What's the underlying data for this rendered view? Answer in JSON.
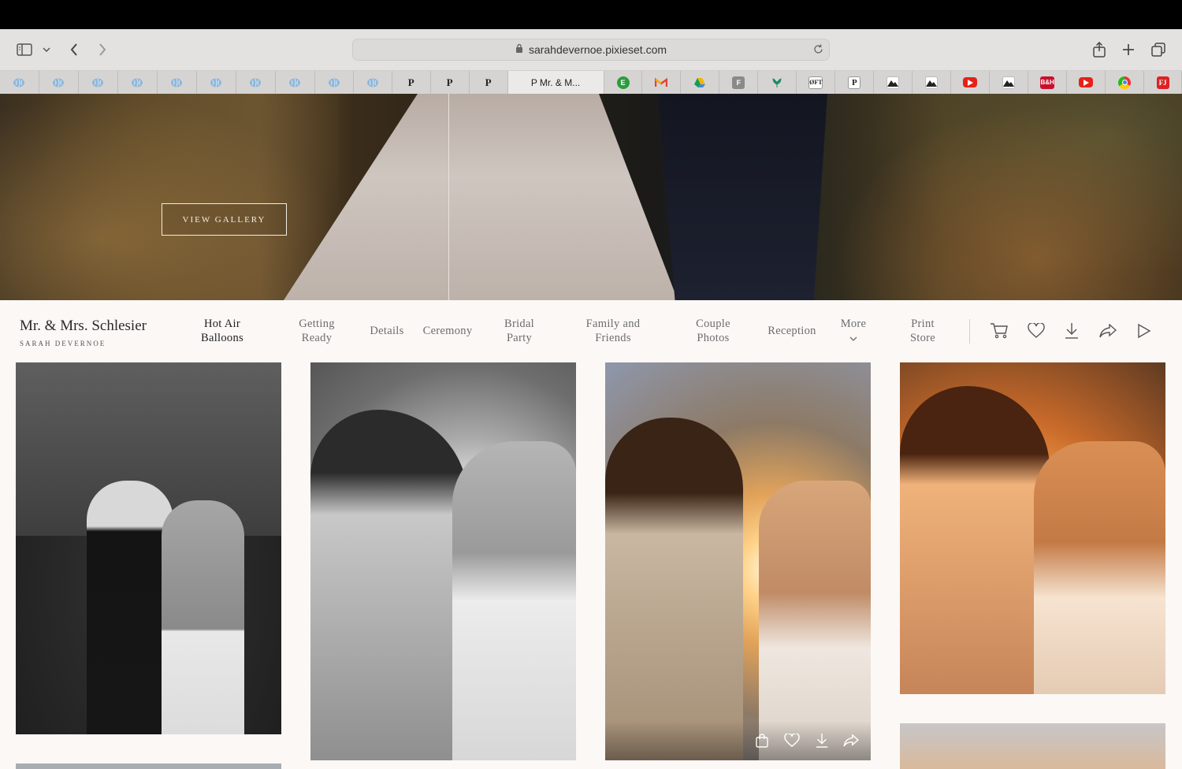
{
  "browser": {
    "url": "sarahdevernoe.pixieset.com",
    "tabs": [
      {
        "favicon": "pinterest-like-blue-icon",
        "label": ""
      },
      {
        "favicon": "pinterest-like-blue-icon",
        "label": ""
      },
      {
        "favicon": "pinterest-like-blue-icon",
        "label": ""
      },
      {
        "favicon": "pinterest-like-blue-icon",
        "label": ""
      },
      {
        "favicon": "pinterest-like-blue-icon",
        "label": ""
      },
      {
        "favicon": "pinterest-like-blue-icon",
        "label": ""
      },
      {
        "favicon": "pinterest-like-blue-icon",
        "label": ""
      },
      {
        "favicon": "pinterest-like-blue-icon",
        "label": ""
      },
      {
        "favicon": "pinterest-like-blue-icon",
        "label": ""
      },
      {
        "favicon": "pinterest-like-blue-icon",
        "label": ""
      },
      {
        "favicon": "pixieset-icon",
        "label": "P"
      },
      {
        "favicon": "pixieset-icon",
        "label": "P"
      },
      {
        "favicon": "pixieset-icon",
        "label": "P"
      },
      {
        "favicon": "pixieset-icon",
        "label": "P  Mr. & M..."
      },
      {
        "favicon": "green-circle-icon",
        "label": ""
      },
      {
        "favicon": "gmail-icon",
        "label": ""
      },
      {
        "favicon": "google-drive-icon",
        "label": ""
      },
      {
        "favicon": "f-icon",
        "label": ""
      },
      {
        "favicon": "plant-icon",
        "label": ""
      },
      {
        "favicon": "ft-icon",
        "label": ""
      },
      {
        "favicon": "p-box-icon",
        "label": ""
      },
      {
        "favicon": "mountain-icon",
        "label": ""
      },
      {
        "favicon": "mountain-icon",
        "label": ""
      },
      {
        "favicon": "youtube-icon",
        "label": ""
      },
      {
        "favicon": "mountain-icon",
        "label": ""
      },
      {
        "favicon": "bh-icon",
        "label": ""
      },
      {
        "favicon": "youtube-icon",
        "label": ""
      },
      {
        "favicon": "chrome-like-icon",
        "label": ""
      },
      {
        "favicon": "fj-icon",
        "label": ""
      }
    ]
  },
  "hero": {
    "button_label": "VIEW GALLERY"
  },
  "gallery": {
    "title": "Mr. & Mrs. Schlesier",
    "subtitle": "SARAH DEVERNOE",
    "nav": [
      {
        "line1": "Hot Air",
        "line2": "Balloons",
        "active": true
      },
      {
        "line1": "Getting",
        "line2": "Ready"
      },
      {
        "line1": "Details",
        "line2": ""
      },
      {
        "line1": "Ceremony",
        "line2": ""
      },
      {
        "line1": "Bridal",
        "line2": "Party"
      },
      {
        "line1": "Family and",
        "line2": "Friends"
      },
      {
        "line1": "Couple",
        "line2": "Photos"
      },
      {
        "line1": "Reception",
        "line2": ""
      },
      {
        "line1": "More",
        "line2": ""
      },
      {
        "line1": "Print",
        "line2": "Store"
      }
    ],
    "actions": [
      "cart-icon",
      "heart-icon",
      "download-icon",
      "share-icon",
      "play-icon"
    ],
    "photo_overlay_actions": [
      "shopping-bag-icon",
      "heart-icon",
      "download-icon",
      "share-icon"
    ]
  },
  "colors": {
    "gallery_bg": "#fbf8f6",
    "nav_active": "#1f1f1f",
    "nav_inactive": "#6d6d6d"
  }
}
